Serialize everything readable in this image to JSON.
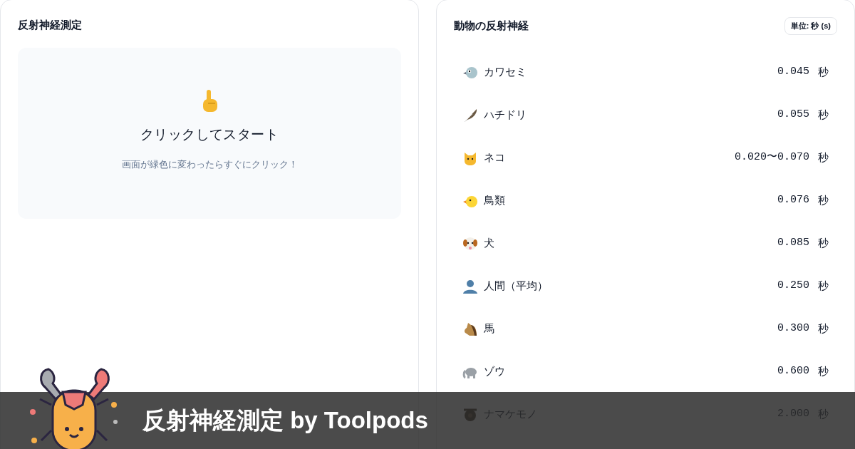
{
  "test_panel": {
    "title": "反射神経測定",
    "prompt": {
      "heading": "クリックしてスタート",
      "hint": "画面が緑色に変わったらすぐにクリック！"
    }
  },
  "animals_panel": {
    "title": "動物の反射神経",
    "unit_badge": "単位: 秒 (s)",
    "rows": [
      {
        "name": "カワセミ",
        "value": "0.045",
        "unit": "秒"
      },
      {
        "name": "ハチドリ",
        "value": "0.055",
        "unit": "秒"
      },
      {
        "name": "ネコ",
        "value": "0.020〜0.070",
        "unit": "秒"
      },
      {
        "name": "鳥類",
        "value": "0.076",
        "unit": "秒"
      },
      {
        "name": "犬",
        "value": "0.085",
        "unit": "秒"
      },
      {
        "name": "人間（平均）",
        "value": "0.250",
        "unit": "秒"
      },
      {
        "name": "馬",
        "value": "0.300",
        "unit": "秒"
      },
      {
        "name": "ゾウ",
        "value": "0.600",
        "unit": "秒"
      },
      {
        "name": "ナマケモノ",
        "value": "2.000",
        "unit": "秒"
      }
    ]
  },
  "banner": {
    "title": "反射神経測定 by Toolpods"
  }
}
